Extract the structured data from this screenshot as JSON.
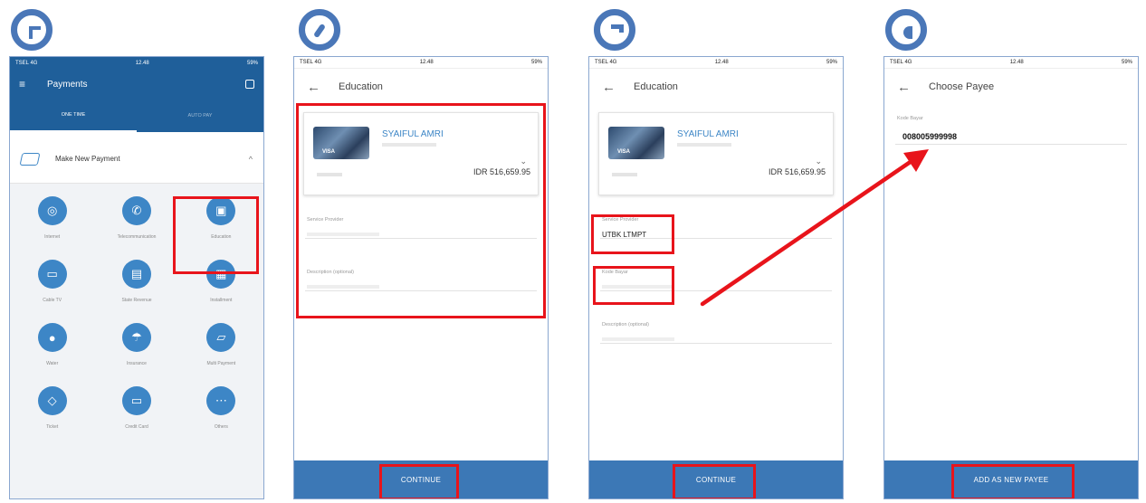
{
  "status_bar": {
    "carrier": "TSEL 4G",
    "time": "12.48",
    "battery": "59%"
  },
  "phone1": {
    "title": "Payments",
    "tabs": [
      "ONE TIME",
      "AUTO PAY"
    ],
    "section": "Make New Payment",
    "items": [
      {
        "label": "Internet",
        "icon": "wifi-icon"
      },
      {
        "label": "Telecommunication",
        "icon": "phone-icon"
      },
      {
        "label": "Education",
        "icon": "graduation-icon"
      },
      {
        "label": "Cable TV",
        "icon": "tv-icon"
      },
      {
        "label": "State Revenue",
        "icon": "document-icon"
      },
      {
        "label": "Installment",
        "icon": "calendar-icon"
      },
      {
        "label": "Water",
        "icon": "water-drop-icon"
      },
      {
        "label": "Insurance",
        "icon": "umbrella-icon"
      },
      {
        "label": "Multi Payment",
        "icon": "cards-icon"
      },
      {
        "label": "Ticket",
        "icon": "ticket-icon"
      },
      {
        "label": "Credit Card",
        "icon": "credit-card-icon"
      },
      {
        "label": "Others",
        "icon": "more-icon"
      }
    ]
  },
  "phone2": {
    "title": "Education",
    "card_name": "SYAIFUL AMRI",
    "amount": "IDR 516,659.95",
    "field1_label": "Service Provider",
    "field2_label": "Description (optional)",
    "button": "CONTINUE"
  },
  "phone3": {
    "title": "Education",
    "card_name": "SYAIFUL AMRI",
    "amount": "IDR 516,659.95",
    "field1_label": "Service Provider",
    "field1_value": "UTBK LTMPT",
    "field2_label": "Kode Bayar",
    "field3_label": "Description (optional)",
    "button": "CONTINUE"
  },
  "phone4": {
    "title": "Choose Payee",
    "field_label": "Kode Bayar",
    "field_value": "008005999998",
    "button": "ADD AS NEW PAYEE"
  },
  "colors": {
    "accent": "#3c78b6",
    "highlight": "#e8141b",
    "badge": "#4a77b8"
  }
}
